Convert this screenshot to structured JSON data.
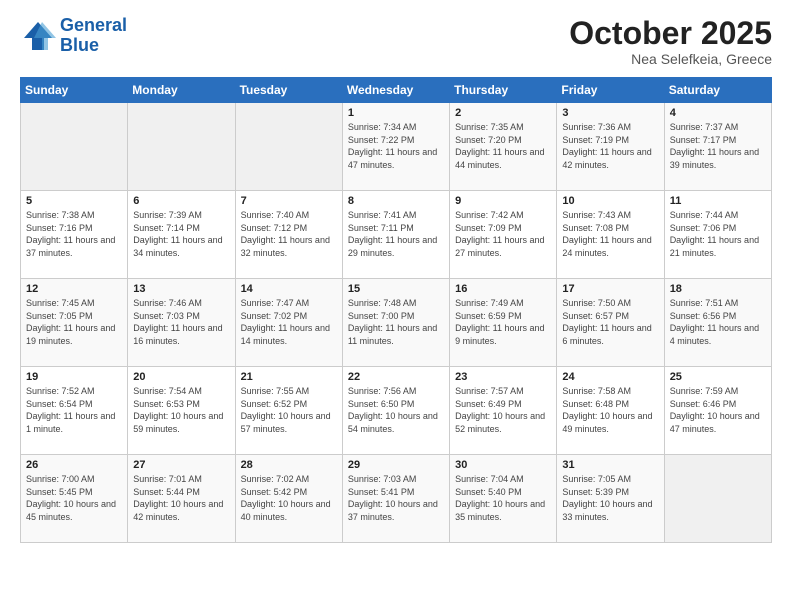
{
  "logo": {
    "line1": "General",
    "line2": "Blue"
  },
  "header": {
    "title": "October 2025",
    "subtitle": "Nea Selefkeia, Greece"
  },
  "weekdays": [
    "Sunday",
    "Monday",
    "Tuesday",
    "Wednesday",
    "Thursday",
    "Friday",
    "Saturday"
  ],
  "weeks": [
    [
      {
        "day": "",
        "empty": true
      },
      {
        "day": "",
        "empty": true
      },
      {
        "day": "",
        "empty": true
      },
      {
        "day": "1",
        "sunrise": "7:34 AM",
        "sunset": "7:22 PM",
        "daylight": "11 hours and 47 minutes."
      },
      {
        "day": "2",
        "sunrise": "7:35 AM",
        "sunset": "7:20 PM",
        "daylight": "11 hours and 44 minutes."
      },
      {
        "day": "3",
        "sunrise": "7:36 AM",
        "sunset": "7:19 PM",
        "daylight": "11 hours and 42 minutes."
      },
      {
        "day": "4",
        "sunrise": "7:37 AM",
        "sunset": "7:17 PM",
        "daylight": "11 hours and 39 minutes."
      }
    ],
    [
      {
        "day": "5",
        "sunrise": "7:38 AM",
        "sunset": "7:16 PM",
        "daylight": "11 hours and 37 minutes."
      },
      {
        "day": "6",
        "sunrise": "7:39 AM",
        "sunset": "7:14 PM",
        "daylight": "11 hours and 34 minutes."
      },
      {
        "day": "7",
        "sunrise": "7:40 AM",
        "sunset": "7:12 PM",
        "daylight": "11 hours and 32 minutes."
      },
      {
        "day": "8",
        "sunrise": "7:41 AM",
        "sunset": "7:11 PM",
        "daylight": "11 hours and 29 minutes."
      },
      {
        "day": "9",
        "sunrise": "7:42 AM",
        "sunset": "7:09 PM",
        "daylight": "11 hours and 27 minutes."
      },
      {
        "day": "10",
        "sunrise": "7:43 AM",
        "sunset": "7:08 PM",
        "daylight": "11 hours and 24 minutes."
      },
      {
        "day": "11",
        "sunrise": "7:44 AM",
        "sunset": "7:06 PM",
        "daylight": "11 hours and 21 minutes."
      }
    ],
    [
      {
        "day": "12",
        "sunrise": "7:45 AM",
        "sunset": "7:05 PM",
        "daylight": "11 hours and 19 minutes."
      },
      {
        "day": "13",
        "sunrise": "7:46 AM",
        "sunset": "7:03 PM",
        "daylight": "11 hours and 16 minutes."
      },
      {
        "day": "14",
        "sunrise": "7:47 AM",
        "sunset": "7:02 PM",
        "daylight": "11 hours and 14 minutes."
      },
      {
        "day": "15",
        "sunrise": "7:48 AM",
        "sunset": "7:00 PM",
        "daylight": "11 hours and 11 minutes."
      },
      {
        "day": "16",
        "sunrise": "7:49 AM",
        "sunset": "6:59 PM",
        "daylight": "11 hours and 9 minutes."
      },
      {
        "day": "17",
        "sunrise": "7:50 AM",
        "sunset": "6:57 PM",
        "daylight": "11 hours and 6 minutes."
      },
      {
        "day": "18",
        "sunrise": "7:51 AM",
        "sunset": "6:56 PM",
        "daylight": "11 hours and 4 minutes."
      }
    ],
    [
      {
        "day": "19",
        "sunrise": "7:52 AM",
        "sunset": "6:54 PM",
        "daylight": "11 hours and 1 minute."
      },
      {
        "day": "20",
        "sunrise": "7:54 AM",
        "sunset": "6:53 PM",
        "daylight": "10 hours and 59 minutes."
      },
      {
        "day": "21",
        "sunrise": "7:55 AM",
        "sunset": "6:52 PM",
        "daylight": "10 hours and 57 minutes."
      },
      {
        "day": "22",
        "sunrise": "7:56 AM",
        "sunset": "6:50 PM",
        "daylight": "10 hours and 54 minutes."
      },
      {
        "day": "23",
        "sunrise": "7:57 AM",
        "sunset": "6:49 PM",
        "daylight": "10 hours and 52 minutes."
      },
      {
        "day": "24",
        "sunrise": "7:58 AM",
        "sunset": "6:48 PM",
        "daylight": "10 hours and 49 minutes."
      },
      {
        "day": "25",
        "sunrise": "7:59 AM",
        "sunset": "6:46 PM",
        "daylight": "10 hours and 47 minutes."
      }
    ],
    [
      {
        "day": "26",
        "sunrise": "7:00 AM",
        "sunset": "5:45 PM",
        "daylight": "10 hours and 45 minutes."
      },
      {
        "day": "27",
        "sunrise": "7:01 AM",
        "sunset": "5:44 PM",
        "daylight": "10 hours and 42 minutes."
      },
      {
        "day": "28",
        "sunrise": "7:02 AM",
        "sunset": "5:42 PM",
        "daylight": "10 hours and 40 minutes."
      },
      {
        "day": "29",
        "sunrise": "7:03 AM",
        "sunset": "5:41 PM",
        "daylight": "10 hours and 37 minutes."
      },
      {
        "day": "30",
        "sunrise": "7:04 AM",
        "sunset": "5:40 PM",
        "daylight": "10 hours and 35 minutes."
      },
      {
        "day": "31",
        "sunrise": "7:05 AM",
        "sunset": "5:39 PM",
        "daylight": "10 hours and 33 minutes."
      },
      {
        "day": "",
        "empty": true
      }
    ]
  ]
}
